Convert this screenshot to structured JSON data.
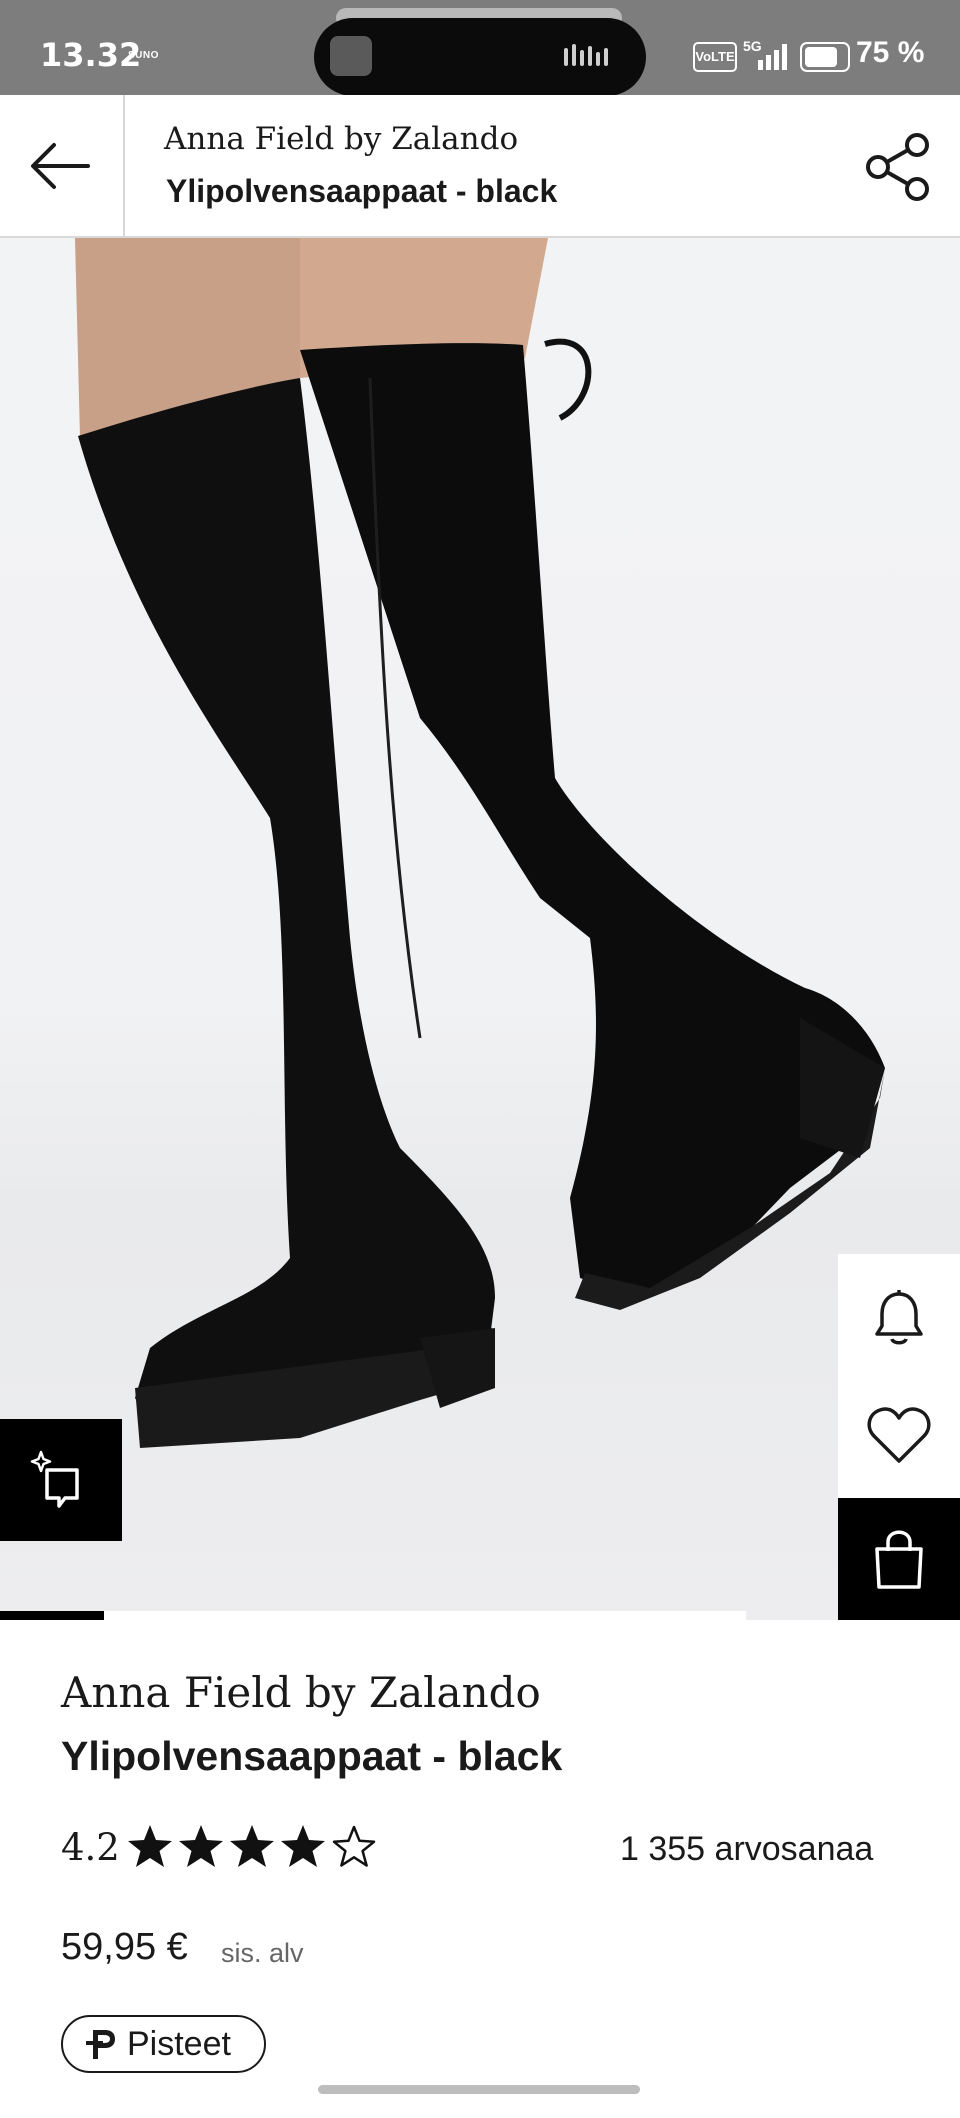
{
  "status_bar": {
    "time": "13.32",
    "time_sub": "SUNO",
    "network_badge": "VoLTE",
    "network_type": "5G",
    "battery_pct": "75 %",
    "battery_level": 0.75
  },
  "header": {
    "brand": "Anna Field by Zalando",
    "product": "Ylipolvensaappaat - black",
    "back_icon": "arrow-left-icon",
    "share_icon": "share-icon"
  },
  "gallery": {
    "progress_fraction": 0.14,
    "side_actions": [
      "bell-icon",
      "heart-icon",
      "shopping-bag-icon"
    ],
    "ai_action": "sparkle-chat-icon"
  },
  "product": {
    "brand": "Anna Field by Zalando",
    "name": "Ylipolvensaappaat - black",
    "rating": "4.2",
    "stars_filled": 4,
    "stars_total": 5,
    "rating_count": "1 355 arvosanaa",
    "price": "59,95 €",
    "vat_note": "sis. alv",
    "points_label": "Pisteet"
  },
  "colors": {
    "status_bar_bg": "#7d7d7d",
    "accent": "#000000",
    "text": "#1a1a1a"
  }
}
